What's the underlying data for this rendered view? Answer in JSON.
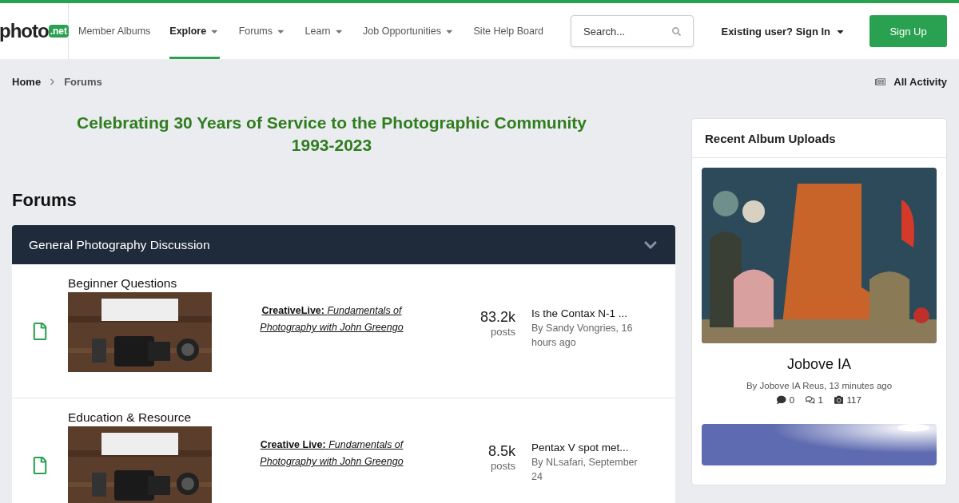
{
  "logo": {
    "text": "photo",
    "badge": ".net"
  },
  "nav": [
    {
      "label": "Member Albums",
      "has_menu": false,
      "selected": false
    },
    {
      "label": "Explore",
      "has_menu": true,
      "selected": true
    },
    {
      "label": "Forums",
      "has_menu": true,
      "selected": false
    },
    {
      "label": "Learn",
      "has_menu": true,
      "selected": false
    },
    {
      "label": "Job Opportunities",
      "has_menu": true,
      "selected": false
    },
    {
      "label": "Site Help Board",
      "has_menu": false,
      "selected": false
    }
  ],
  "search": {
    "placeholder": "Search..."
  },
  "sign_in": "Existing user? Sign In",
  "sign_up": "Sign Up",
  "breadcrumb": [
    "Home",
    "Forums"
  ],
  "all_activity": "All Activity",
  "banner": [
    "Celebrating 30 Years of Service to the Photographic Community",
    "1993-2023"
  ],
  "page_title": "Forums",
  "category": {
    "title": "General Photography Discussion",
    "expanded": true,
    "forums": [
      {
        "title": "Beginner Questions",
        "link": "**CreativeLive:** *Fundamentals of Photography with John Greengo*",
        "count": "83.2k",
        "count_label": "posts",
        "last_title": "Is the Contax N-1 ...",
        "last_by": "By Sandy Vongries, 16 hours ago"
      },
      {
        "title": "Education & Resource",
        "link": "**Creative Live:** *Fundamentals of Photography with John Greengo*",
        "count": "8.5k",
        "count_label": "posts",
        "last_title": "Pentax V spot met...",
        "last_by": "By NLsafari, September 24"
      }
    ]
  },
  "sidebar": {
    "title": "Recent Album Uploads",
    "albums": [
      {
        "kind": "painting",
        "title": "Jobove IA",
        "by": "By Jobove IA Reus, 13 minutes ago",
        "comments": "0",
        "replies": "1",
        "images": "117"
      },
      {
        "kind": "sky"
      }
    ]
  }
}
